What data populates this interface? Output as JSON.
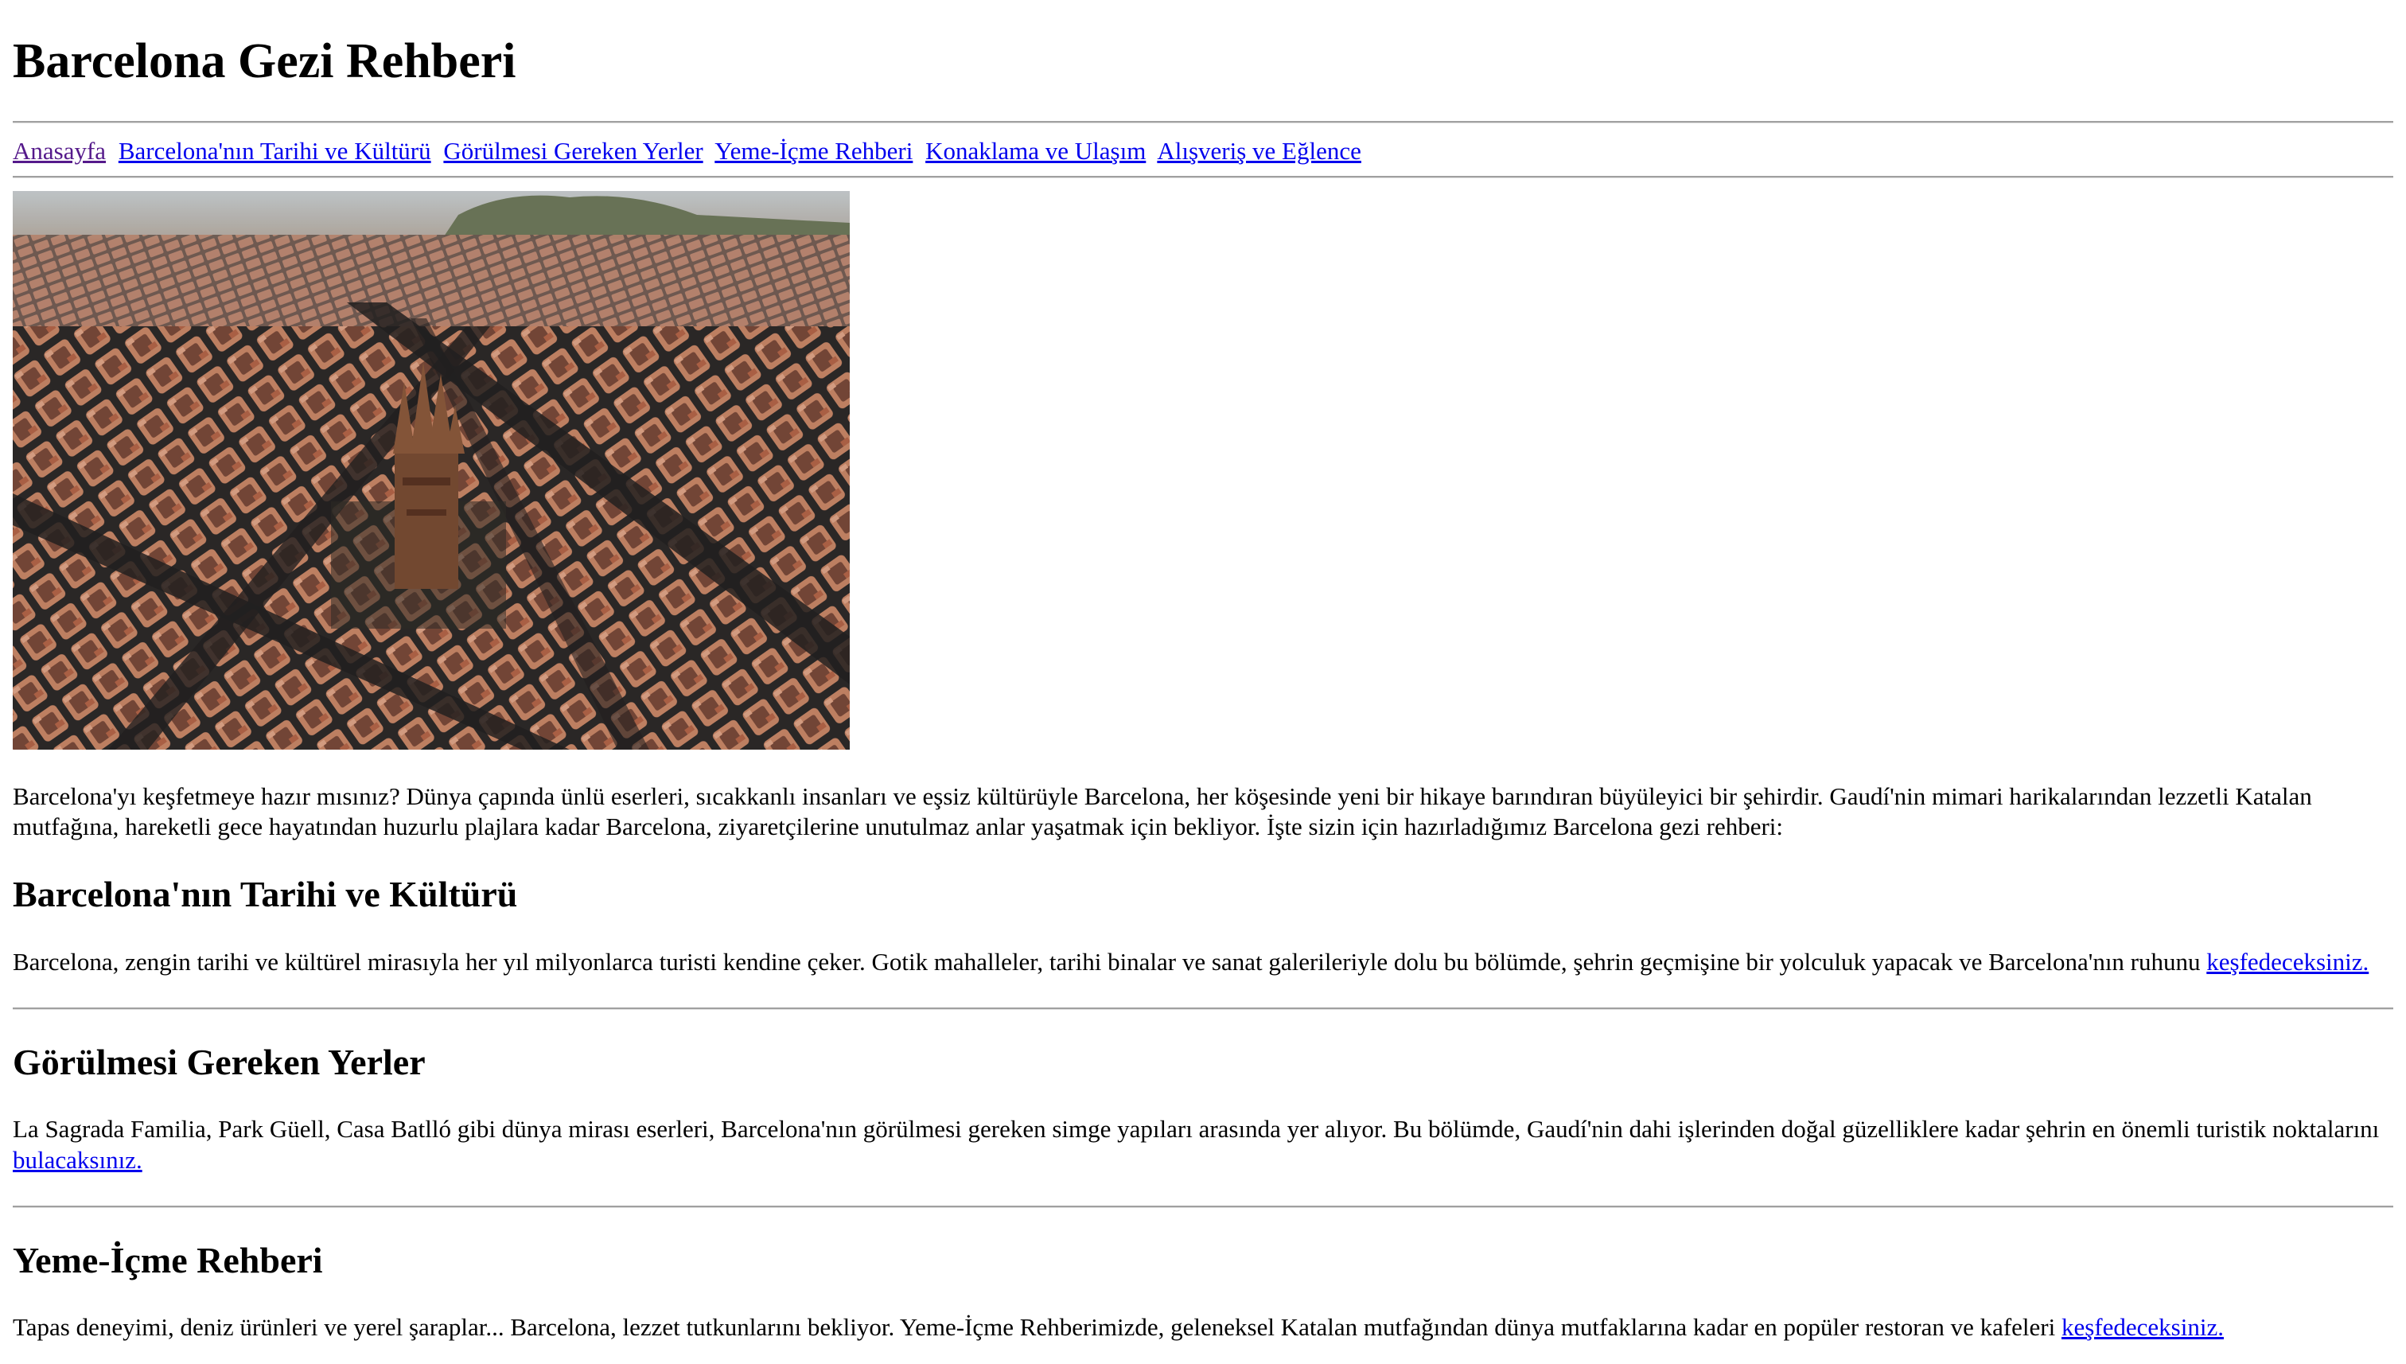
{
  "page": {
    "title": "Barcelona Gezi Rehberi"
  },
  "nav": {
    "items": [
      {
        "label": "Anasayfa",
        "visited": true
      },
      {
        "label": "Barcelona'nın Tarihi ve Kültürü",
        "visited": false
      },
      {
        "label": "Görülmesi Gereken Yerler",
        "visited": false
      },
      {
        "label": "Yeme-İçme Rehberi",
        "visited": false
      },
      {
        "label": "Konaklama ve Ulaşım",
        "visited": false
      },
      {
        "label": "Alışveriş ve Eğlence",
        "visited": false
      }
    ]
  },
  "hero": {
    "alt": "Barcelona aerial view"
  },
  "intro": {
    "text": "Barcelona'yı keşfetmeye hazır mısınız? Dünya çapında ünlü eserleri, sıcakkanlı insanları ve eşsiz kültürüyle Barcelona, her köşesinde yeni bir hikaye barındıran büyüleyici bir şehirdir. Gaudí'nin mimari harikalarından lezzetli Katalan mutfağına, hareketli gece hayatından huzurlu plajlara kadar Barcelona, ziyaretçilerine unutulmaz anlar yaşatmak için bekliyor. İşte sizin için hazırladığımız Barcelona gezi rehberi:"
  },
  "sections": [
    {
      "heading": "Barcelona'nın Tarihi ve Kültürü",
      "text": "Barcelona, zengin tarihi ve kültürel mirasıyla her yıl milyonlarca turisti kendine çeker. Gotik mahalleler, tarihi binalar ve sanat galerileriyle dolu bu bölümde, şehrin geçmişine bir yolculuk yapacak ve Barcelona'nın ruhunu ",
      "link": "keşfedeceksiniz."
    },
    {
      "heading": "Görülmesi Gereken Yerler",
      "text": "La Sagrada Familia, Park Güell, Casa Batlló gibi dünya mirası eserleri, Barcelona'nın görülmesi gereken simge yapıları arasında yer alıyor. Bu bölümde, Gaudí'nin dahi işlerinden doğal güzelliklere kadar şehrin en önemli turistik noktalarını ",
      "link": "bulacaksınız."
    },
    {
      "heading": "Yeme-İçme Rehberi",
      "text": "Tapas deneyimi, deniz ürünleri ve yerel şaraplar... Barcelona, lezzet tutkunlarını bekliyor. Yeme-İçme Rehberimizde, geleneksel Katalan mutfağından dünya mutfaklarına kadar en popüler restoran ve kafeleri ",
      "link": "keşfedeceksiniz."
    }
  ],
  "colors": {
    "link": "#0000ee",
    "visited": "#551a8b",
    "rule": "#a0a0a0"
  }
}
